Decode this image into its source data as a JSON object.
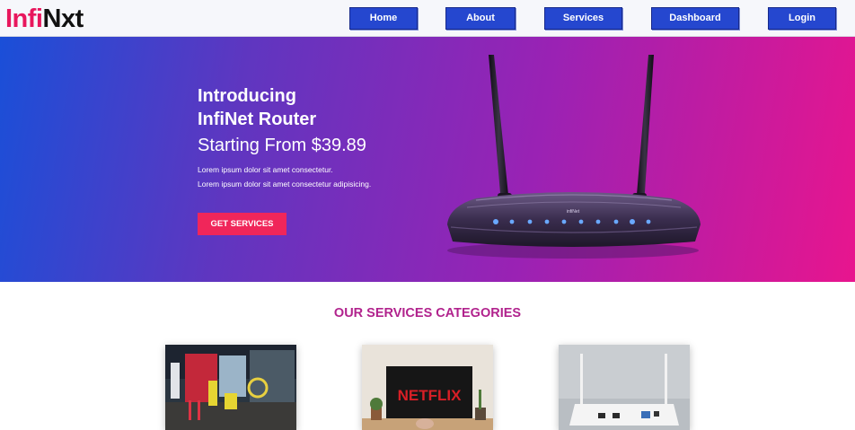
{
  "brand": {
    "logo_part1": "Infi",
    "logo_part2": "Nxt"
  },
  "nav": {
    "home": "Home",
    "about": "About",
    "services": "Services",
    "dashboard": "Dashboard",
    "login": "Login"
  },
  "hero": {
    "title_line1": "Introducing",
    "title_line2": "InfiNet Router",
    "price_text": "Starting From $39.89",
    "text_line1": "Lorem ipsum dolor sit amet consectetur.",
    "text_line2": "Lorem ipsum dolor sit amet consectetur adipisicing.",
    "cta_label": "GET SERVICES",
    "router_brand": "infiNet"
  },
  "services": {
    "heading": "OUR SERVICES CATEGORIES",
    "cards": [
      {
        "icon": "installation-photo"
      },
      {
        "icon": "netflix-tv-photo",
        "tv_text": "NETFLIX"
      },
      {
        "icon": "router-photo"
      }
    ]
  },
  "colors": {
    "nav_button": "#2547cf",
    "accent_pink": "#e8175d",
    "cta": "#f0265a",
    "section_title": "#b1238d"
  }
}
